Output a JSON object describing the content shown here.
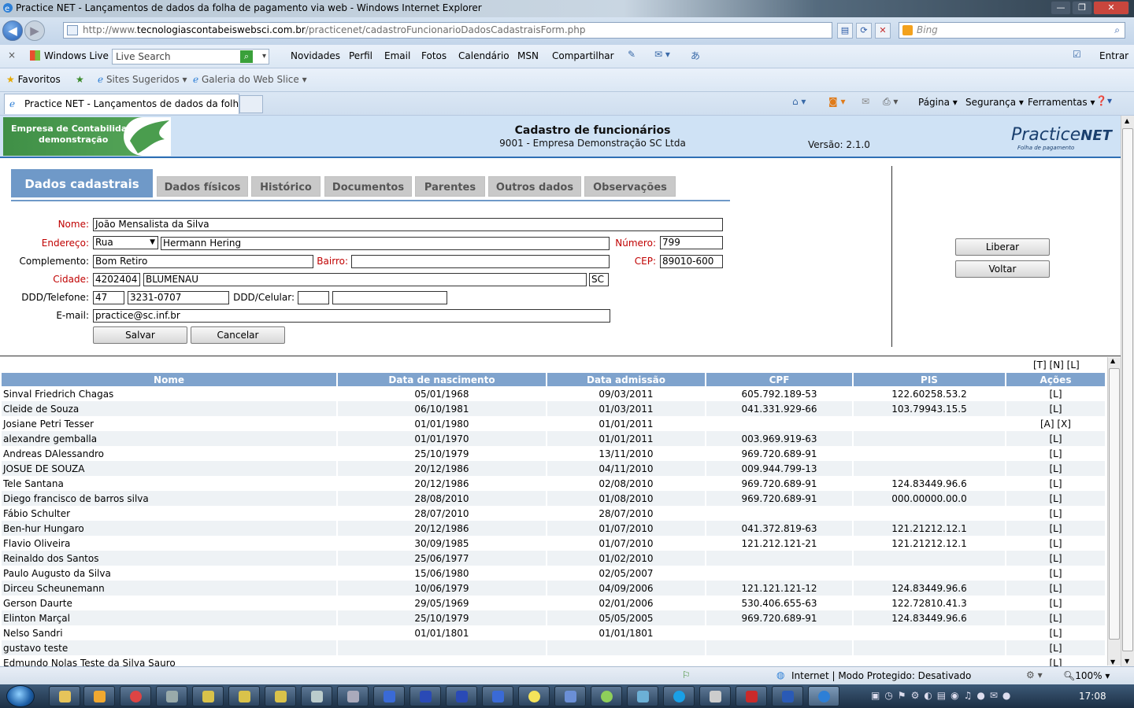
{
  "window": {
    "title": "Practice NET - Lançamentos de dados da folha de pagamento via web - Windows Internet Explorer"
  },
  "address": {
    "prefix": "http://www.",
    "host": "tecnologiascontabeiswebsci.com.br",
    "path": "/practicenet/cadastroFuncionarioDadosCadastraisForm.php",
    "search_placeholder": "Bing"
  },
  "livebar": {
    "close": "×",
    "brand": "Windows Live",
    "search_placeholder": "Live Search",
    "links": [
      "Novidades",
      "Perfil",
      "Email",
      "Fotos",
      "Calendário",
      "MSN",
      "Compartilhar"
    ],
    "signin": "Entrar"
  },
  "favbar": {
    "favorites": "Favoritos",
    "suggested": "Sites Sugeridos ▾",
    "gallery": "Galeria do Web Slice ▾"
  },
  "tabbar": {
    "tab_label": "Practice NET - Lançamentos de dados da folha d...",
    "menus": [
      "Página ▾",
      "Segurança ▾",
      "Ferramentas ▾"
    ]
  },
  "banner": {
    "logo_line1": "Empresa de Contabilidade",
    "logo_line2": "demonstração",
    "title": "Cadastro de funcionários",
    "company": "9001 - Empresa Demonstração SC Ltda",
    "version": "Versão: 2.1.0",
    "brand": "Practice",
    "brand_suffix": "NET",
    "brand_tagline": "Folha de pagamento"
  },
  "tabs": [
    "Dados cadastrais",
    "Dados físicos",
    "Histórico",
    "Documentos",
    "Parentes",
    "Outros dados",
    "Observações"
  ],
  "form": {
    "labels": {
      "nome": "Nome:",
      "endereco": "Endereço:",
      "numero": "Número:",
      "complemento": "Complemento:",
      "bairro": "Bairro:",
      "cep": "CEP:",
      "cidade": "Cidade:",
      "telefone": "DDD/Telefone:",
      "celular": "DDD/Celular:",
      "email": "E-mail:"
    },
    "values": {
      "nome": "João Mensalista da Silva",
      "tipo_logradouro": "Rua",
      "logradouro": "Hermann Hering",
      "numero": "799",
      "complemento": "Bom Retiro",
      "bairro": "",
      "cep": "89010-600",
      "cidade_codigo": "4202404",
      "cidade_nome": "BLUMENAU",
      "uf": "SC",
      "ddd": "47",
      "telefone": "3231-0707",
      "ddd_celular": "",
      "celular": "",
      "email": "practice@sc.inf.br"
    },
    "buttons": {
      "salvar": "Salvar",
      "cancelar": "Cancelar"
    }
  },
  "side_buttons": {
    "liberar": "Liberar",
    "voltar": "Voltar"
  },
  "table_links": "[T] [N] [L]",
  "table": {
    "columns": [
      "Nome",
      "Data de nascimento",
      "Data admissão",
      "CPF",
      "PIS",
      "Ações"
    ],
    "rows": [
      [
        "Sinval Friedrich Chagas",
        "05/01/1968",
        "09/03/2011",
        "605.792.189-53",
        "122.60258.53.2",
        "[L]"
      ],
      [
        "Cleide de Souza",
        "06/10/1981",
        "01/03/2011",
        "041.331.929-66",
        "103.79943.15.5",
        "[L]"
      ],
      [
        "Josiane Petri Tesser",
        "01/01/1980",
        "01/01/2011",
        "",
        "",
        "[A] [X]"
      ],
      [
        "alexandre gemballa",
        "01/01/1970",
        "01/01/2011",
        "003.969.919-63",
        "",
        "[L]"
      ],
      [
        "Andreas DAlessandro",
        "25/10/1979",
        "13/11/2010",
        "969.720.689-91",
        "",
        "[L]"
      ],
      [
        "JOSUE DE SOUZA",
        "20/12/1986",
        "04/11/2010",
        "009.944.799-13",
        "",
        "[L]"
      ],
      [
        "Tele Santana",
        "20/12/1986",
        "02/08/2010",
        "969.720.689-91",
        "124.83449.96.6",
        "[L]"
      ],
      [
        "Diego francisco de barros silva",
        "28/08/2010",
        "01/08/2010",
        "969.720.689-91",
        "000.00000.00.0",
        "[L]"
      ],
      [
        "Fábio Schulter",
        "28/07/2010",
        "28/07/2010",
        "",
        "",
        "[L]"
      ],
      [
        "Ben-hur Hungaro",
        "20/12/1986",
        "01/07/2010",
        "041.372.819-63",
        "121.21212.12.1",
        "[L]"
      ],
      [
        "Flavio Oliveira",
        "30/09/1985",
        "01/07/2010",
        "121.212.121-21",
        "121.21212.12.1",
        "[L]"
      ],
      [
        "Reinaldo dos Santos",
        "25/06/1977",
        "01/02/2010",
        "",
        "",
        "[L]"
      ],
      [
        "Paulo Augusto da Silva",
        "15/06/1980",
        "02/05/2007",
        "",
        "",
        "[L]"
      ],
      [
        "Dirceu Scheunemann",
        "10/06/1979",
        "04/09/2006",
        "121.121.121-12",
        "124.83449.96.6",
        "[L]"
      ],
      [
        "Gerson Daurte",
        "29/05/1969",
        "02/01/2006",
        "530.406.655-63",
        "122.72810.41.3",
        "[L]"
      ],
      [
        "Elinton Marçal",
        "25/10/1979",
        "05/05/2005",
        "969.720.689-91",
        "124.83449.96.6",
        "[L]"
      ],
      [
        "Nelso Sandri",
        "01/01/1801",
        "01/01/1801",
        "",
        "",
        "[L]"
      ],
      [
        "gustavo teste",
        "",
        "",
        "",
        "",
        "[L]"
      ],
      [
        "Edmundo Nolas Teste da Silva Sauro",
        "",
        "",
        "",
        "",
        "[L]"
      ]
    ]
  },
  "statusbar": {
    "zone": "Internet | Modo Protegido: Desativado",
    "zoom": "100%"
  },
  "taskbar": {
    "time": "17:08"
  }
}
